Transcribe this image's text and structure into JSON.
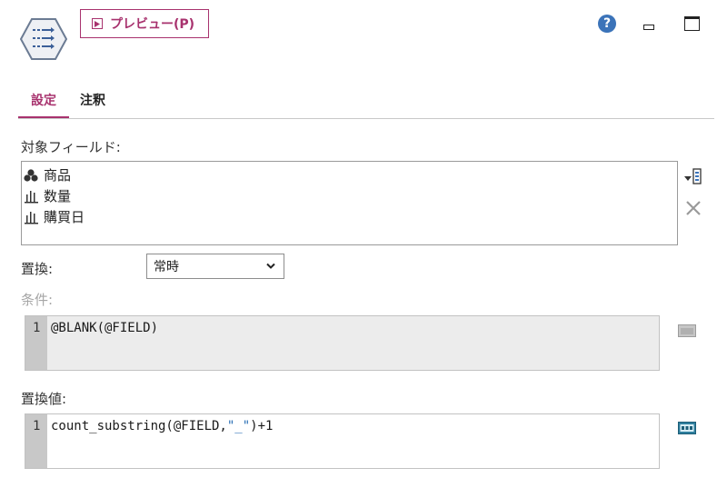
{
  "header": {
    "preview_label": "プレビュー(P)",
    "help_symbol": "?"
  },
  "tabs": [
    {
      "label": "設定",
      "active": true
    },
    {
      "label": "注釈",
      "active": false
    }
  ],
  "fields": {
    "label": "対象フィールド:",
    "items": [
      {
        "icon": "nominal-icon",
        "name": "商品"
      },
      {
        "icon": "continuous-icon",
        "name": "数量"
      },
      {
        "icon": "continuous-icon",
        "name": "購買日"
      }
    ]
  },
  "replace": {
    "label": "置換:",
    "selected": "常時"
  },
  "condition": {
    "label": "条件:",
    "line_number": "1",
    "code": "@BLANK(@FIELD)",
    "disabled": true
  },
  "replace_value": {
    "label": "置換値:",
    "line_number": "1",
    "code_prefix": "count_substring(@FIELD,",
    "code_string": "\"_\"",
    "code_suffix": ")+1"
  },
  "colors": {
    "accent": "#a8326e",
    "help": "#3b73b9",
    "string": "#2a6fb5"
  }
}
